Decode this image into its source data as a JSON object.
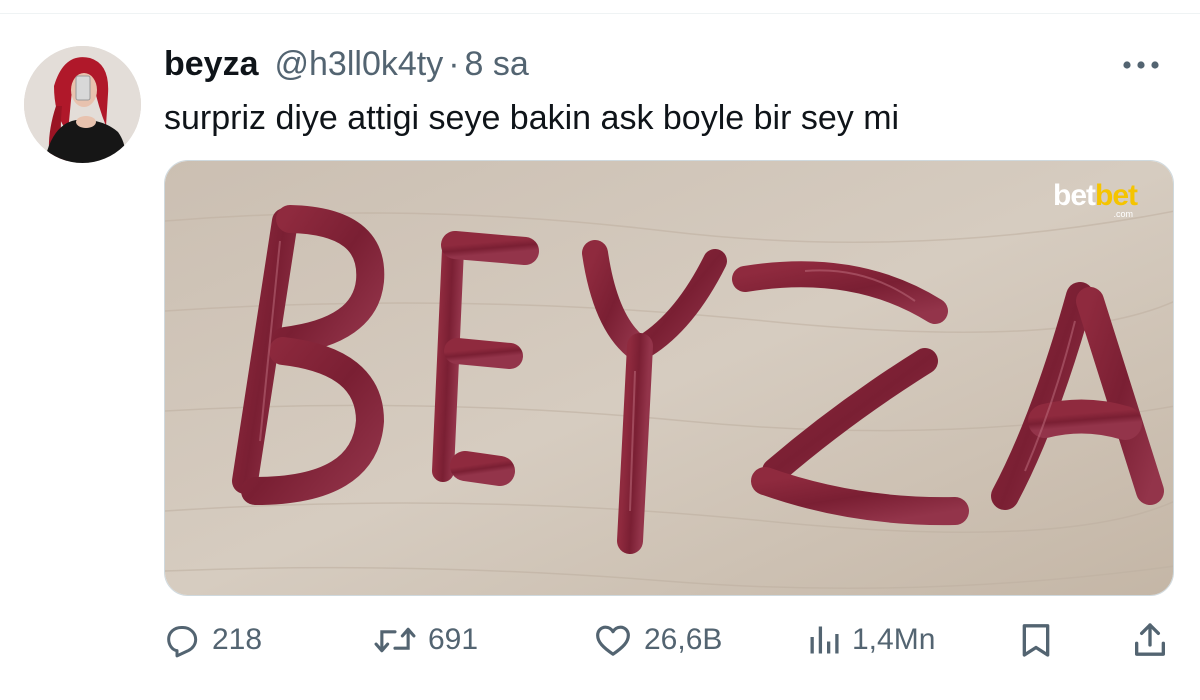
{
  "tweet": {
    "display_name": "beyza",
    "handle": "@h3ll0k4ty",
    "separator": "·",
    "time": "8 sa",
    "text": "surpriz diye attigi seye bakin ask boyle bir sey mi",
    "media": {
      "watermark_main": "bet",
      "watermark_accent": "bet",
      "watermark_sub": ".com"
    }
  },
  "actions": {
    "replies": "218",
    "reposts": "691",
    "likes": "26,6B",
    "views": "1,4Mn"
  },
  "icons": {
    "more": "more-horizontal-icon",
    "reply": "reply-bubble-icon",
    "repost": "repost-arrows-icon",
    "like": "heart-icon",
    "views": "bar-chart-icon",
    "bookmark": "bookmark-icon",
    "share": "share-upload-icon"
  },
  "colors": {
    "text_primary": "#0f1419",
    "text_secondary": "#536471",
    "border": "#cfd9de"
  }
}
